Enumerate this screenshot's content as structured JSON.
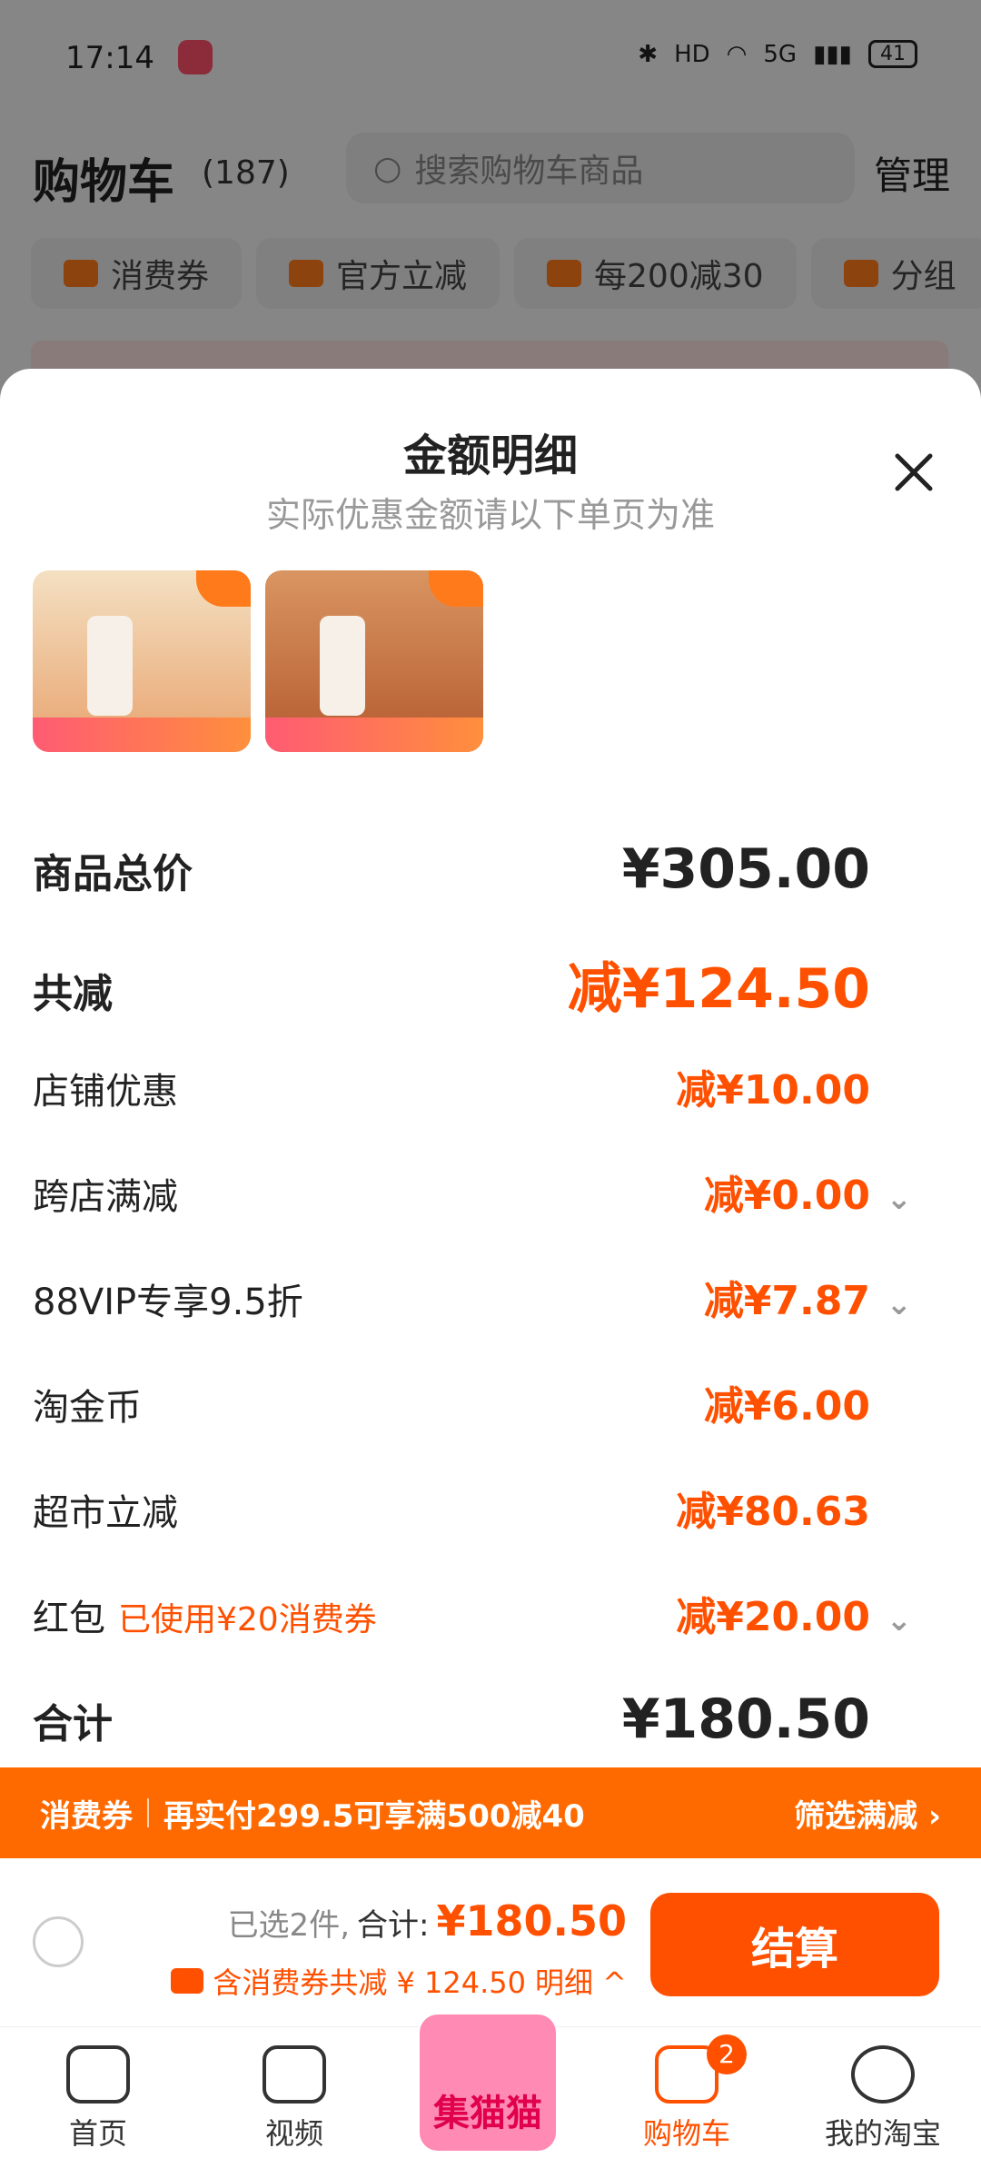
{
  "status": {
    "time": "17:14",
    "network": "5G",
    "battery": "41"
  },
  "header": {
    "title": "购物车",
    "count": "(187)",
    "search_placeholder": "搜索购物车商品",
    "manage": "管理"
  },
  "chips": [
    "消费券",
    "官方立减",
    "每200减30",
    "分组"
  ],
  "sheet": {
    "title": "金额明细",
    "subtitle": "实际优惠金额请以下单页为准",
    "rows": [
      {
        "label": "商品总价",
        "value": "¥305.00"
      },
      {
        "label": "共减",
        "value": "减¥124.50"
      },
      {
        "label": "店铺优惠",
        "value": "减¥10.00"
      },
      {
        "label": "跨店满减",
        "value": "减¥0.00"
      },
      {
        "label": "88VIP专享9.5折",
        "value": "减¥7.87"
      },
      {
        "label": "淘金币",
        "value": "减¥6.00"
      },
      {
        "label": "超市立减",
        "value": "减¥80.63"
      },
      {
        "label": "红包",
        "note": "已使用¥20消费券",
        "value": "减¥20.00"
      },
      {
        "label": "合计",
        "value": "¥180.50"
      }
    ]
  },
  "banner": {
    "tag": "消费券",
    "text": "再实付299.5可享满500减40",
    "action": "筛选满减 ›"
  },
  "checkout": {
    "selected": "已选2件,",
    "total_label": "合计:",
    "total": "¥180.50",
    "discount": "含消费券共减 ¥ 124.50",
    "detail": "明细 ^",
    "button": "结算"
  },
  "tabs": [
    {
      "label": "首页"
    },
    {
      "label": "视频"
    },
    {
      "label": "集猫猫"
    },
    {
      "label": "购物车",
      "badge": "2"
    },
    {
      "label": "我的淘宝"
    }
  ],
  "colors": {
    "accent": "#ff5000",
    "banner": "#ff6a00"
  }
}
